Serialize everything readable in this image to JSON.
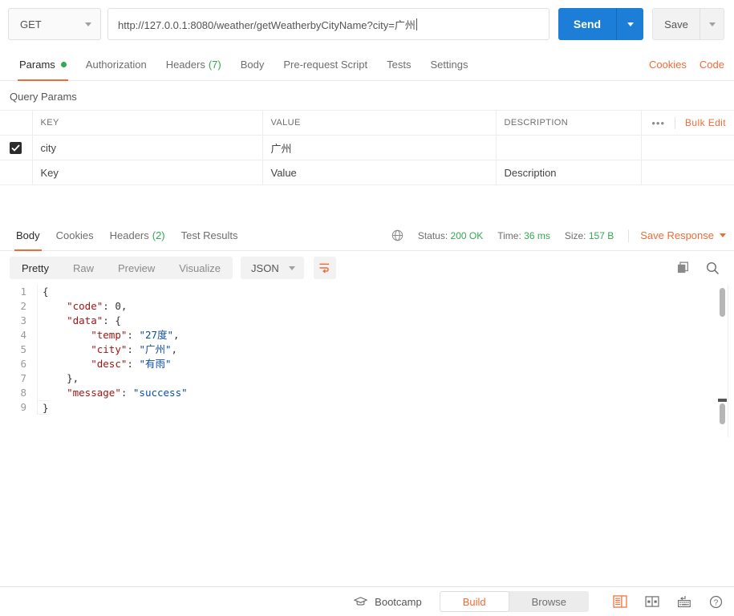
{
  "url_bar": {
    "method": "GET",
    "url": "http://127.0.0.1:8080/weather/getWeatherbyCityName?city=广州",
    "send_label": "Send",
    "save_label": "Save"
  },
  "request_tabs": {
    "items": [
      {
        "label": "Params",
        "badge": "",
        "has_dot": true,
        "active": true
      },
      {
        "label": "Authorization",
        "badge": "",
        "has_dot": false,
        "active": false
      },
      {
        "label": "Headers",
        "badge": "(7)",
        "has_dot": false,
        "active": false
      },
      {
        "label": "Body",
        "badge": "",
        "has_dot": false,
        "active": false
      },
      {
        "label": "Pre-request Script",
        "badge": "",
        "has_dot": false,
        "active": false
      },
      {
        "label": "Tests",
        "badge": "",
        "has_dot": false,
        "active": false
      },
      {
        "label": "Settings",
        "badge": "",
        "has_dot": false,
        "active": false
      }
    ],
    "cookies_label": "Cookies",
    "code_label": "Code"
  },
  "query_params": {
    "section_title": "Query Params",
    "headers": [
      "KEY",
      "VALUE",
      "DESCRIPTION"
    ],
    "bulk_edit_label": "Bulk Edit",
    "rows": [
      {
        "checked": true,
        "key": "city",
        "value": "广州",
        "description": ""
      }
    ],
    "placeholder_row": {
      "key": "Key",
      "value": "Value",
      "description": "Description"
    }
  },
  "response": {
    "tabs": [
      {
        "label": "Body",
        "badge": "",
        "active": true
      },
      {
        "label": "Cookies",
        "badge": "",
        "active": false
      },
      {
        "label": "Headers",
        "badge": "(2)",
        "active": false
      },
      {
        "label": "Test Results",
        "badge": "",
        "active": false
      }
    ],
    "status_label": "Status:",
    "status_value": "200 OK",
    "time_label": "Time:",
    "time_value": "36 ms",
    "size_label": "Size:",
    "size_value": "157 B",
    "save_response_label": "Save Response",
    "view_modes": [
      {
        "label": "Pretty",
        "active": true
      },
      {
        "label": "Raw",
        "active": false
      },
      {
        "label": "Preview",
        "active": false
      },
      {
        "label": "Visualize",
        "active": false
      }
    ],
    "format": "JSON",
    "body_lines": [
      {
        "n": "1",
        "tokens": [
          {
            "t": "punc",
            "v": "{"
          }
        ]
      },
      {
        "n": "2",
        "tokens": [
          {
            "t": "punc",
            "v": "    "
          },
          {
            "t": "key",
            "v": "\"code\""
          },
          {
            "t": "punc",
            "v": ": "
          },
          {
            "t": "num",
            "v": "0"
          },
          {
            "t": "punc",
            "v": ","
          }
        ]
      },
      {
        "n": "3",
        "tokens": [
          {
            "t": "punc",
            "v": "    "
          },
          {
            "t": "key",
            "v": "\"data\""
          },
          {
            "t": "punc",
            "v": ": {"
          }
        ]
      },
      {
        "n": "4",
        "tokens": [
          {
            "t": "punc",
            "v": "        "
          },
          {
            "t": "key",
            "v": "\"temp\""
          },
          {
            "t": "punc",
            "v": ": "
          },
          {
            "t": "str",
            "v": "\"27度\""
          },
          {
            "t": "punc",
            "v": ","
          }
        ]
      },
      {
        "n": "5",
        "tokens": [
          {
            "t": "punc",
            "v": "        "
          },
          {
            "t": "key",
            "v": "\"city\""
          },
          {
            "t": "punc",
            "v": ": "
          },
          {
            "t": "str",
            "v": "\"广州\""
          },
          {
            "t": "punc",
            "v": ","
          }
        ]
      },
      {
        "n": "6",
        "tokens": [
          {
            "t": "punc",
            "v": "        "
          },
          {
            "t": "key",
            "v": "\"desc\""
          },
          {
            "t": "punc",
            "v": ": "
          },
          {
            "t": "str",
            "v": "\"有雨\""
          }
        ]
      },
      {
        "n": "7",
        "tokens": [
          {
            "t": "punc",
            "v": "    },"
          }
        ]
      },
      {
        "n": "8",
        "tokens": [
          {
            "t": "punc",
            "v": "    "
          },
          {
            "t": "key",
            "v": "\"message\""
          },
          {
            "t": "punc",
            "v": ": "
          },
          {
            "t": "str",
            "v": "\"success\""
          }
        ]
      },
      {
        "n": "9",
        "tokens": [
          {
            "t": "punc",
            "v": "}"
          }
        ]
      }
    ]
  },
  "bottom_bar": {
    "bootcamp_label": "Bootcamp",
    "build_label": "Build",
    "browse_label": "Browse"
  },
  "colors": {
    "accent": "#ef6c37",
    "send_blue": "#1c7ed6",
    "status_green": "#34a853",
    "json_key": "#a31515",
    "json_string": "#0b4fa8"
  }
}
